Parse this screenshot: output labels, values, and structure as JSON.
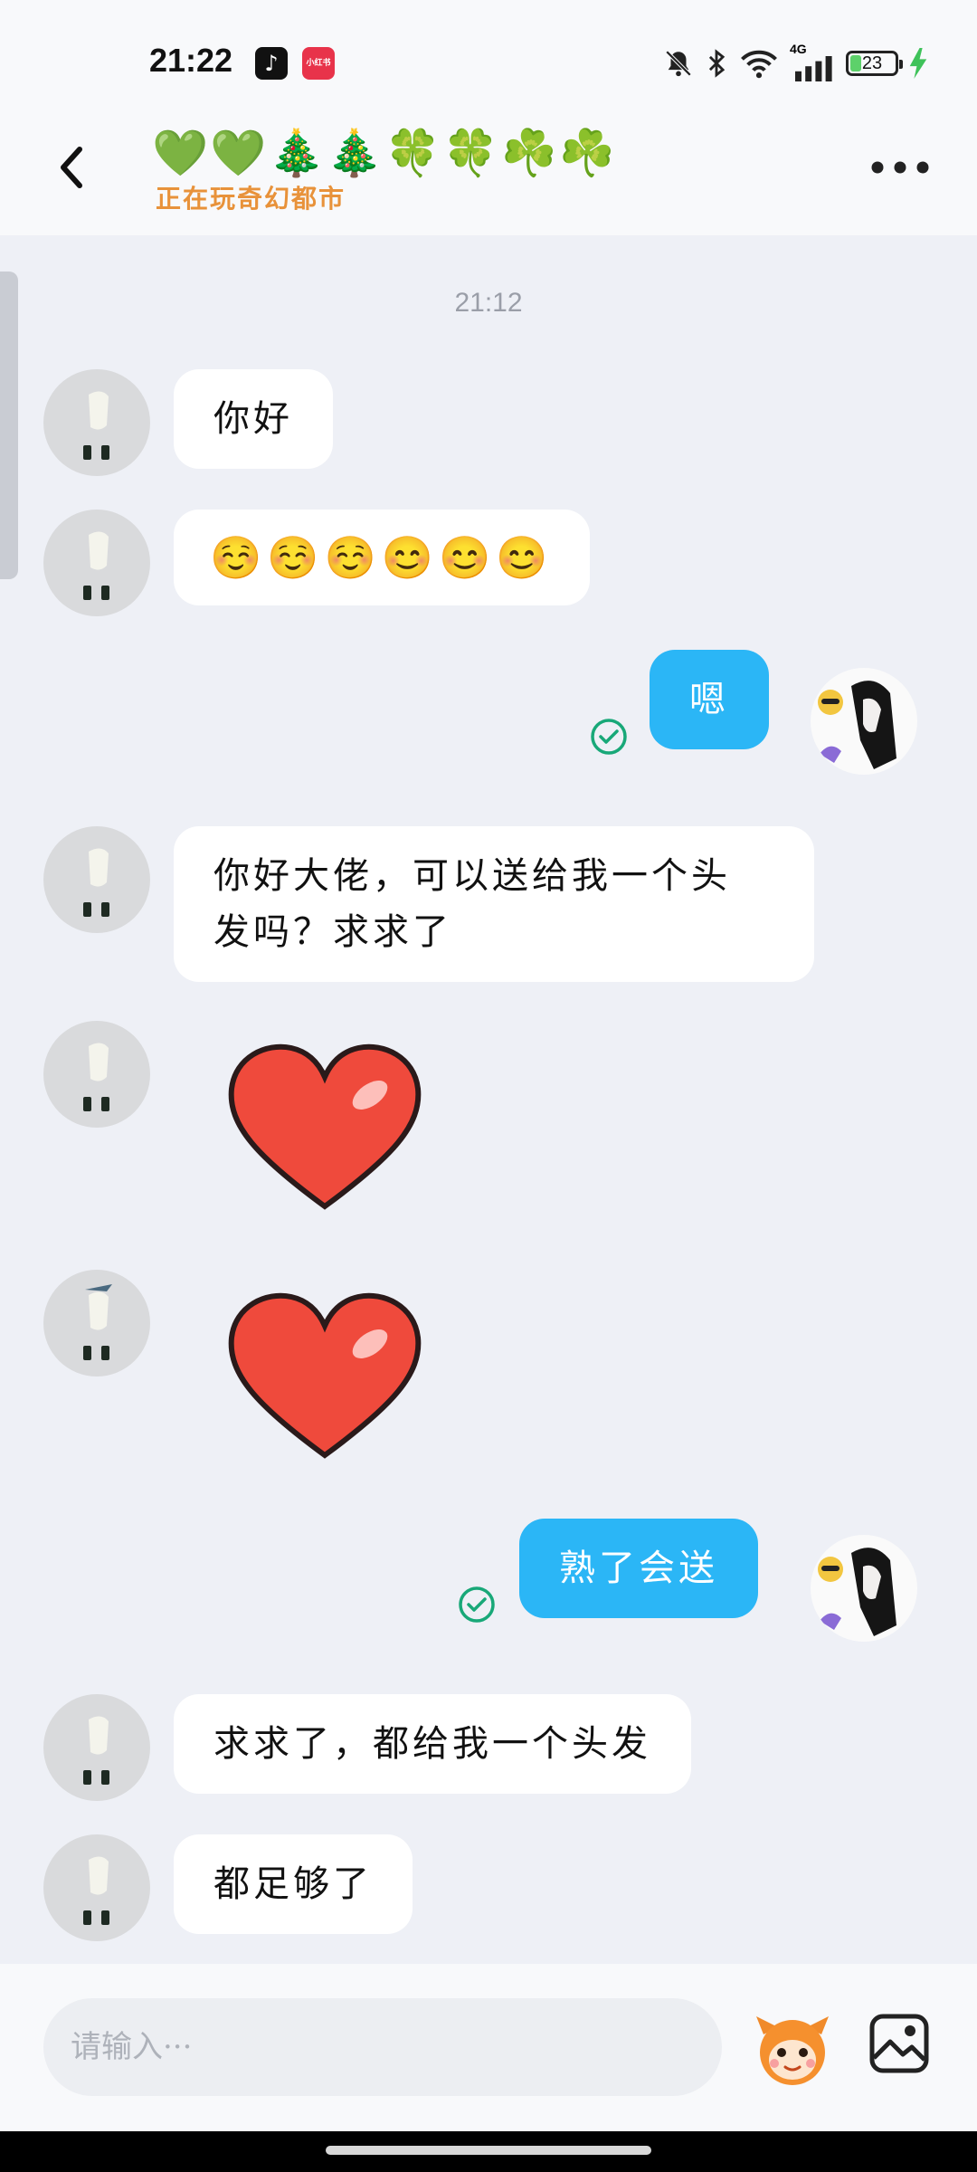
{
  "status_bar": {
    "time": "21:22",
    "apps": [
      {
        "icon": "tiktok-icon",
        "color": "#111111",
        "label": "♪"
      },
      {
        "icon": "xiaohongshu-icon",
        "color": "#e8334a",
        "label": "小红书"
      }
    ],
    "signal": "4G",
    "battery": "23"
  },
  "header": {
    "title": "💚💚🎄🎄🍀🍀☘️☘️",
    "status": "正在玩奇幻都市"
  },
  "chat": {
    "timestamp": "21:12",
    "messages": [
      {
        "side": "in",
        "type": "text",
        "text": "你好"
      },
      {
        "side": "in",
        "type": "emoji",
        "text": "☺️☺️☺️😊😊😊"
      },
      {
        "side": "out",
        "type": "text",
        "text": "嗯",
        "read": true
      },
      {
        "side": "in",
        "type": "text",
        "text": "你好大佬，可以送给我一个头",
        "text2": "发吗？求求了"
      },
      {
        "side": "in",
        "type": "sticker",
        "sticker": "red-heart"
      },
      {
        "side": "in",
        "type": "sticker",
        "sticker": "red-heart"
      },
      {
        "side": "out",
        "type": "text",
        "text": "熟了会送",
        "read": true
      },
      {
        "side": "in",
        "type": "text",
        "text": "求求了，都给我一个头发"
      },
      {
        "side": "in",
        "type": "text",
        "text": "都足够了"
      }
    ]
  },
  "input": {
    "placeholder": "请输入···"
  },
  "colors": {
    "outgoing_bubble": "#2bb6f6",
    "incoming_bubble": "#ffffff",
    "read_check": "#18a878",
    "status_text": "#e8923a"
  }
}
